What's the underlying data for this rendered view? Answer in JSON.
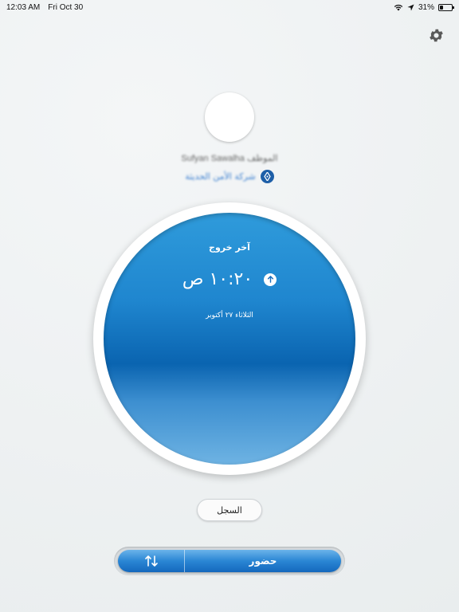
{
  "status_bar": {
    "time": "12:03 AM",
    "date": "Fri Oct 30",
    "battery_percent": "31%",
    "battery_level": 0.31,
    "icons": [
      "wifi-icon",
      "location-arrow-icon",
      "battery-icon"
    ]
  },
  "header": {
    "settings_icon": "gear-icon"
  },
  "profile": {
    "name": "Sufyan Sawalha الموظف",
    "organization": "شركة الأمن الحديثة",
    "org_icon": "compass-icon"
  },
  "attendance": {
    "title": "آخر خروج",
    "time": "١٠:٢٠ ص",
    "direction_icon": "arrow-up-icon",
    "date": "الثلاثاء ٢٧ أكتوبر"
  },
  "log_button": {
    "label": "السجل"
  },
  "action_bar": {
    "swap_icon": "swap-arrows-icon",
    "checkin_label": "حضور"
  },
  "colors": {
    "disc_top": "#2f9bdb",
    "disc_mid": "#0a64b0",
    "accent": "#1e5fa8",
    "link": "#3b7fd0"
  }
}
